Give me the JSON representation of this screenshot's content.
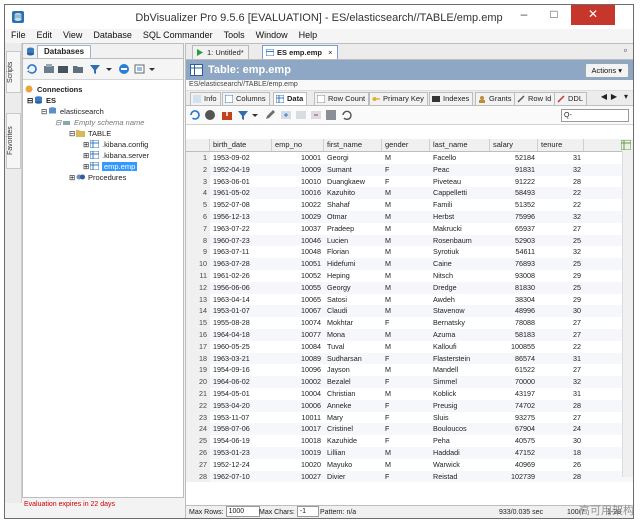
{
  "window": {
    "title": "DbVisualizer Pro 9.5.6 [EVALUATION] - ES/elasticsearch//TABLE/emp.emp",
    "minimize": "–",
    "maximize": "□",
    "close": "✕"
  },
  "menu": [
    "File",
    "Edit",
    "View",
    "Database",
    "SQL Commander",
    "Tools",
    "Window",
    "Help"
  ],
  "side_tabs": {
    "scripts": "Scripts",
    "favorites": "Favorites"
  },
  "databases_panel": {
    "tab": "Databases",
    "tree": [
      {
        "label": "Connections",
        "level": 0
      },
      {
        "label": "ES",
        "level": 1
      },
      {
        "label": "elasticsearch",
        "level": 2
      },
      {
        "label": "Empty schema name",
        "level": 3
      },
      {
        "label": "TABLE",
        "level": 4
      },
      {
        "label": ".kibana.config",
        "level": 5
      },
      {
        "label": ".kibana.server",
        "level": 5
      },
      {
        "label": "emp.emp",
        "level": 5,
        "selected": true
      },
      {
        "label": "Procedures",
        "level": 4
      }
    ]
  },
  "eval_notice": "Evaluation expires in 22 days",
  "doc_tabs": [
    {
      "label": "1: Untitled*",
      "active": false
    },
    {
      "label": "ES emp.emp",
      "active": true
    }
  ],
  "object_header": {
    "title": "Table: emp.emp",
    "actions": "Actions"
  },
  "breadcrumb": "ES/elasticsearch//TABLE/emp.emp",
  "sub_tabs": [
    "Info",
    "Columns",
    "Data",
    "Row Count",
    "Primary Key",
    "Indexes",
    "Grants",
    "Row Id",
    "DDL"
  ],
  "active_sub_tab": "Data",
  "search_placeholder": "Q-",
  "columns": [
    "birth_date",
    "emp_no",
    "first_name",
    "gender",
    "last_name",
    "salary",
    "tenure"
  ],
  "rows": [
    [
      "1",
      "1953-09-02",
      "10001",
      "Georgi",
      "M",
      "Facello",
      "52184",
      "31"
    ],
    [
      "2",
      "1952-04-19",
      "10009",
      "Sumant",
      "F",
      "Peac",
      "91831",
      "32"
    ],
    [
      "3",
      "1963-06-01",
      "10010",
      "Duangkaew",
      "F",
      "Piveteau",
      "91222",
      "28"
    ],
    [
      "4",
      "1961-05-02",
      "10016",
      "Kazuhito",
      "M",
      "Cappelletti",
      "58493",
      "22"
    ],
    [
      "5",
      "1952-07-08",
      "10022",
      "Shahaf",
      "M",
      "Famili",
      "51352",
      "22"
    ],
    [
      "6",
      "1956-12-13",
      "10029",
      "Otmar",
      "M",
      "Herbst",
      "75996",
      "32"
    ],
    [
      "7",
      "1963-07-22",
      "10037",
      "Pradeep",
      "M",
      "Makrucki",
      "65937",
      "27"
    ],
    [
      "8",
      "1960-07-23",
      "10046",
      "Lucien",
      "M",
      "Rosenbaum",
      "52903",
      "25"
    ],
    [
      "9",
      "1963-07-11",
      "10048",
      "Florian",
      "M",
      "Syrotiuk",
      "54611",
      "32"
    ],
    [
      "10",
      "1963-07-28",
      "10051",
      "Hidefumi",
      "M",
      "Caine",
      "76893",
      "25"
    ],
    [
      "11",
      "1961-02-26",
      "10052",
      "Heping",
      "M",
      "Nitsch",
      "93008",
      "29"
    ],
    [
      "12",
      "1956-06-06",
      "10055",
      "Georgy",
      "M",
      "Dredge",
      "81830",
      "25"
    ],
    [
      "13",
      "1963-04-14",
      "10065",
      "Satosi",
      "M",
      "Awdeh",
      "38304",
      "29"
    ],
    [
      "14",
      "1953-01-07",
      "10067",
      "Claudi",
      "M",
      "Stavenow",
      "48996",
      "30"
    ],
    [
      "15",
      "1955-08-28",
      "10074",
      "Mokhtar",
      "F",
      "Bernatsky",
      "78088",
      "27"
    ],
    [
      "16",
      "1964-04-18",
      "10077",
      "Mona",
      "M",
      "Azuma",
      "58183",
      "27"
    ],
    [
      "17",
      "1960-05-25",
      "10084",
      "Tuval",
      "M",
      "Kalloufi",
      "100855",
      "22"
    ],
    [
      "18",
      "1963-03-21",
      "10089",
      "Sudharsan",
      "F",
      "Flasterstein",
      "86574",
      "31"
    ],
    [
      "19",
      "1954-09-16",
      "10096",
      "Jayson",
      "M",
      "Mandell",
      "61522",
      "27"
    ],
    [
      "20",
      "1964-06-02",
      "10002",
      "Bezalel",
      "F",
      "Simmel",
      "70000",
      "32"
    ],
    [
      "21",
      "1954-05-01",
      "10004",
      "Christian",
      "M",
      "Koblick",
      "43197",
      "31"
    ],
    [
      "22",
      "1953-04-20",
      "10006",
      "Anneke",
      "F",
      "Preusig",
      "74702",
      "28"
    ],
    [
      "23",
      "1953-11-07",
      "10011",
      "Mary",
      "F",
      "Sluis",
      "93275",
      "27"
    ],
    [
      "24",
      "1958-07-06",
      "10017",
      "Cristinel",
      "F",
      "Bouloucos",
      "67904",
      "24"
    ],
    [
      "25",
      "1954-06-19",
      "10018",
      "Kazuhide",
      "F",
      "Peha",
      "40575",
      "30"
    ],
    [
      "26",
      "1953-01-23",
      "10019",
      "Lillian",
      "M",
      "Haddadi",
      "47152",
      "18"
    ],
    [
      "27",
      "1952-12-24",
      "10020",
      "Mayuko",
      "M",
      "Warwick",
      "40969",
      "26"
    ],
    [
      "28",
      "1962-07-10",
      "10027",
      "Divier",
      "F",
      "Reistad",
      "102739",
      "28"
    ]
  ],
  "footer": {
    "max_rows_label": "Max Rows:",
    "max_rows": "1000",
    "max_chars_label": "Max Chars:",
    "max_chars": "-1",
    "pattern": "Pattern: n/a",
    "exec_time": "933/0.035 sec",
    "row_info": "100/7",
    "range": "1-28"
  },
  "watermark": "高可用架构"
}
